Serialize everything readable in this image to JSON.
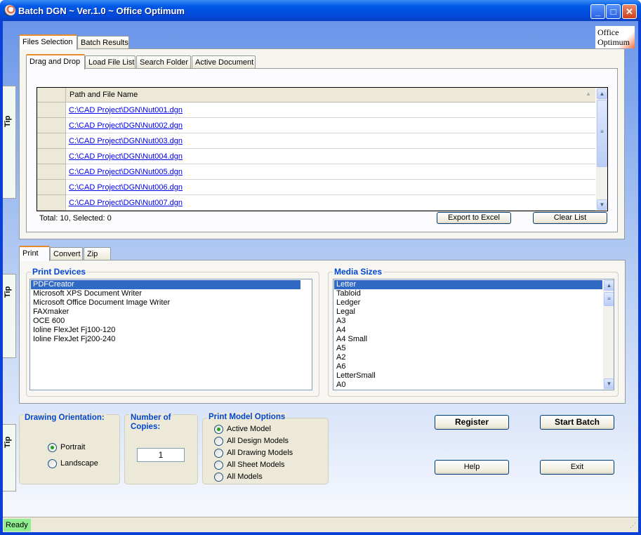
{
  "window": {
    "title": "Batch DGN ~ Ver.1.0 ~ Office Optimum",
    "minimize": "_",
    "maximize": "□",
    "close": "✕"
  },
  "logo": {
    "line1": "Office",
    "line2": "Optimum"
  },
  "top_tabs": [
    {
      "label": "Files Selection",
      "selected": true
    },
    {
      "label": "Batch Results"
    }
  ],
  "source_tabs": [
    {
      "label": "Drag and Drop",
      "selected": true
    },
    {
      "label": "Load File List"
    },
    {
      "label": "Search Folder"
    },
    {
      "label": "Active Document"
    }
  ],
  "file_grid": {
    "column": "Path and File Name",
    "rows": [
      "C:\\CAD Project\\DGN\\Nut001.dgn",
      "C:\\CAD Project\\DGN\\Nut002.dgn",
      "C:\\CAD Project\\DGN\\Nut003.dgn",
      "C:\\CAD Project\\DGN\\Nut004.dgn",
      "C:\\CAD Project\\DGN\\Nut005.dgn",
      "C:\\CAD Project\\DGN\\Nut006.dgn",
      "C:\\CAD Project\\DGN\\Nut007.dgn"
    ]
  },
  "file_status": "Total: 10, Selected: 0",
  "export_label": "Export to Excel",
  "clear_label": "Clear List",
  "tip_label": "Tip",
  "action_tabs": [
    {
      "label": "Print",
      "selected": true
    },
    {
      "label": "Convert"
    },
    {
      "label": "Zip"
    }
  ],
  "print_devices": {
    "title": "Print Devices",
    "items": [
      "PDFCreator",
      "Microsoft XPS Document Writer",
      "Microsoft Office Document Image Writer",
      "FAXmaker",
      "OCE 600",
      "Ioline FlexJet Fj100-120",
      "Ioline FlexJet Fj200-240"
    ],
    "selected": 0
  },
  "media_sizes": {
    "title": "Media Sizes",
    "items": [
      "Letter",
      "Tabloid",
      "Ledger",
      "Legal",
      "A3",
      "A4",
      "A4 Small",
      "A5",
      "A2",
      "A6",
      "LetterSmall",
      "A0"
    ],
    "selected": 0
  },
  "orientation": {
    "title": "Drawing Orientation:",
    "options": [
      "Portrait",
      "Landscape"
    ],
    "selected": 0
  },
  "copies": {
    "title_line1": "Number of",
    "title_line2": "Copies:",
    "value": "1"
  },
  "model_options": {
    "title": "Print Model Options",
    "options": [
      "Active Model",
      "All Design Models",
      "All Drawing Models",
      "All Sheet Models",
      "All Models"
    ],
    "selected": 0
  },
  "buttons": {
    "register": "Register",
    "start_batch": "Start Batch",
    "help": "Help",
    "exit": "Exit"
  },
  "status": {
    "text": "Ready",
    "color": "#90ee90"
  }
}
